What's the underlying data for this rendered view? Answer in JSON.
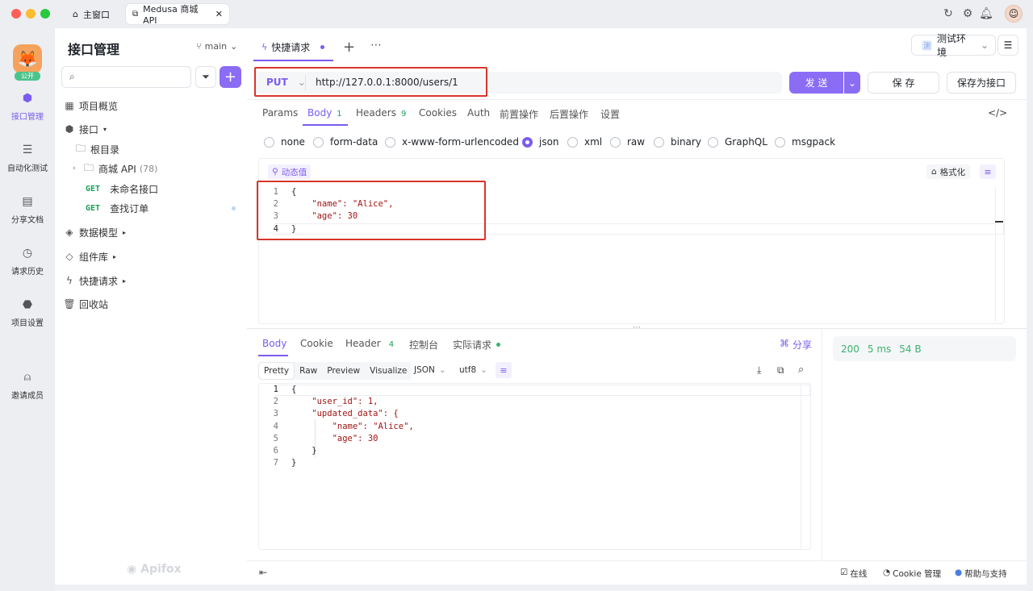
{
  "window": {
    "tabs": [
      {
        "label": "主窗口"
      },
      {
        "label": "Medusa 商城 API"
      }
    ]
  },
  "colors": {
    "accent": "#7b5cf0",
    "get": "#19a05a",
    "highlight": "#d9342b"
  },
  "rail": {
    "badge": "公开",
    "items": [
      {
        "label": "接口管理"
      },
      {
        "label": "自动化测试"
      },
      {
        "label": "分享文档"
      },
      {
        "label": "请求历史"
      },
      {
        "label": "项目设置"
      },
      {
        "label": "邀请成员"
      }
    ]
  },
  "panel": {
    "title": "接口管理",
    "branch": "main",
    "search_placeholder": "",
    "tree": [
      {
        "label": "项目概览"
      },
      {
        "label": "接口"
      },
      {
        "label": "根目录"
      },
      {
        "label": "商城 API",
        "count": "(78)"
      },
      {
        "method": "GET",
        "label": "未命名接口"
      },
      {
        "method": "GET",
        "label": "查找订单"
      },
      {
        "label": "数据模型"
      },
      {
        "label": "组件库"
      },
      {
        "label": "快捷请求"
      },
      {
        "label": "回收站"
      }
    ],
    "watermark": "Apifox"
  },
  "editor": {
    "tab_label": "快捷请求",
    "env": "测试环境",
    "method": "PUT",
    "url": "http://127.0.0.1:8000/users/1",
    "send": "发 送",
    "save": "保 存",
    "save_as": "保存为接口",
    "req_tabs": [
      {
        "label": "Params"
      },
      {
        "label": "Body",
        "count": "1"
      },
      {
        "label": "Headers",
        "count": "9"
      },
      {
        "label": "Cookies"
      },
      {
        "label": "Auth"
      },
      {
        "label": "前置操作"
      },
      {
        "label": "后置操作"
      },
      {
        "label": "设置"
      }
    ],
    "body_types": [
      {
        "label": "none"
      },
      {
        "label": "form-data"
      },
      {
        "label": "x-www-form-urlencoded"
      },
      {
        "label": "json",
        "selected": true
      },
      {
        "label": "xml"
      },
      {
        "label": "raw"
      },
      {
        "label": "binary"
      },
      {
        "label": "GraphQL"
      },
      {
        "label": "msgpack"
      }
    ],
    "dynamic_value": "动态值",
    "format": "格式化",
    "body_lines": [
      {
        "n": "1",
        "text": "{"
      },
      {
        "n": "2",
        "text": "    \"name\": \"Alice\","
      },
      {
        "n": "3",
        "text": "    \"age\": 30"
      },
      {
        "n": "4",
        "text": "}"
      }
    ]
  },
  "response": {
    "tabs": [
      {
        "label": "Body"
      },
      {
        "label": "Cookie"
      },
      {
        "label": "Header",
        "count": "4"
      },
      {
        "label": "控制台"
      },
      {
        "label": "实际请求"
      }
    ],
    "share": "分享",
    "view_modes": [
      "Pretty",
      "Raw",
      "Preview",
      "Visualize"
    ],
    "format": "JSON",
    "encoding": "utf8",
    "status": "200",
    "time": "5 ms",
    "size": "54 B",
    "lines": [
      {
        "n": "1",
        "text": "{"
      },
      {
        "n": "2",
        "text": "    \"user_id\": 1,"
      },
      {
        "n": "3",
        "text": "    \"updated_data\": {"
      },
      {
        "n": "4",
        "text": "        \"name\": \"Alice\","
      },
      {
        "n": "5",
        "text": "        \"age\": 30"
      },
      {
        "n": "6",
        "text": "    }"
      },
      {
        "n": "7",
        "text": "}"
      }
    ]
  },
  "statusbar": {
    "online": "在线",
    "cookie": "Cookie 管理",
    "help": "帮助与支持"
  }
}
